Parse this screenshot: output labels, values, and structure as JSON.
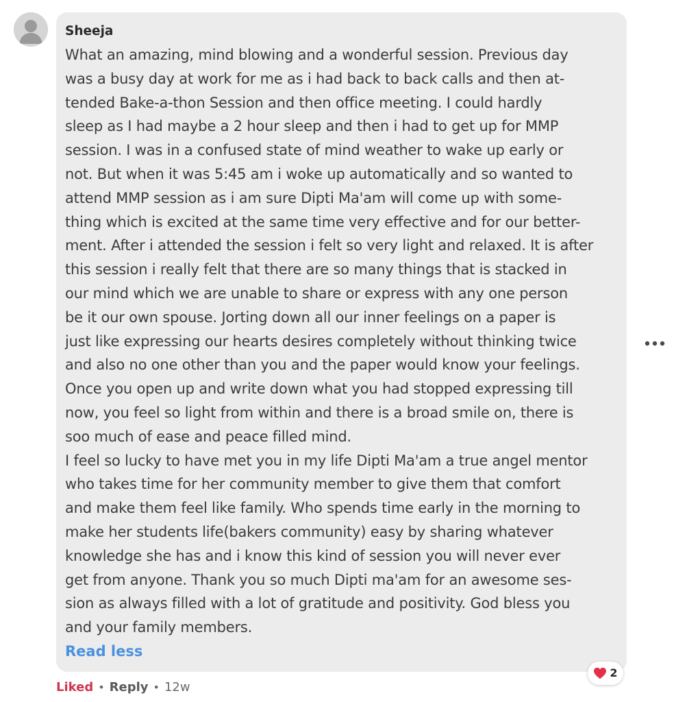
{
  "comment": {
    "author": "Sheeja",
    "lines": [
      "What an amazing, mind blowing and a wonderful session. Previous day",
      "was a busy day at work for me as i had back to back calls and then at-",
      "tended Bake-a-thon Session and then office meeting. I could hardly",
      "sleep as I had maybe a 2 hour sleep and then i had to get up for MMP",
      "session. I was in a confused state of mind weather to wake up early or",
      "not. But when it was 5:45 am i woke up automatically and so wanted to",
      "attend MMP session as i am sure Dipti Ma'am will come up with some-",
      "thing which is excited at the same time very effective and for our better-",
      "ment. After i attended the session i felt so very light and relaxed. It is after",
      "this session i really felt that there are so many things that is stacked in",
      "our mind which we are unable to share or express with any one person",
      "be it our own spouse. Jorting down all our inner feelings on a paper is",
      "just like expressing our hearts desires completely without thinking twice",
      "and also no one other than you and the paper would know your feelings.",
      "Once you open up and write down what you had stopped expressing till",
      "now, you feel so light from within and there is a broad smile on, there is",
      "soo much of ease and peace filled mind.",
      "I feel so lucky to have met you in my life Dipti Ma'am a true angel mentor",
      "who takes time for her community member to give them that comfort",
      "and make them feel like family. Who spends time early in the morning to",
      "make her students life(bakers community) easy by sharing whatever",
      "knowledge she has and  i know this kind of session you will never ever",
      "get from anyone. Thank you so much Dipti ma'am for an awesome ses-",
      "sion as always filled with a lot of gratitude and positivity. God bless you",
      "and your family members."
    ],
    "read_less_label": "Read less",
    "reaction_count": "2",
    "liked_label": "Liked",
    "separator": "•",
    "reply_label": "Reply",
    "age": "12w"
  },
  "colors": {
    "bubble_bg": "#ececec",
    "link_blue": "#4a90e2",
    "liked_red": "#d0364f",
    "heart_red": "#e0304a"
  },
  "icons": {
    "avatar": "default-user-avatar-icon",
    "more": "more-horizontal-icon",
    "reaction": "heart-icon"
  }
}
